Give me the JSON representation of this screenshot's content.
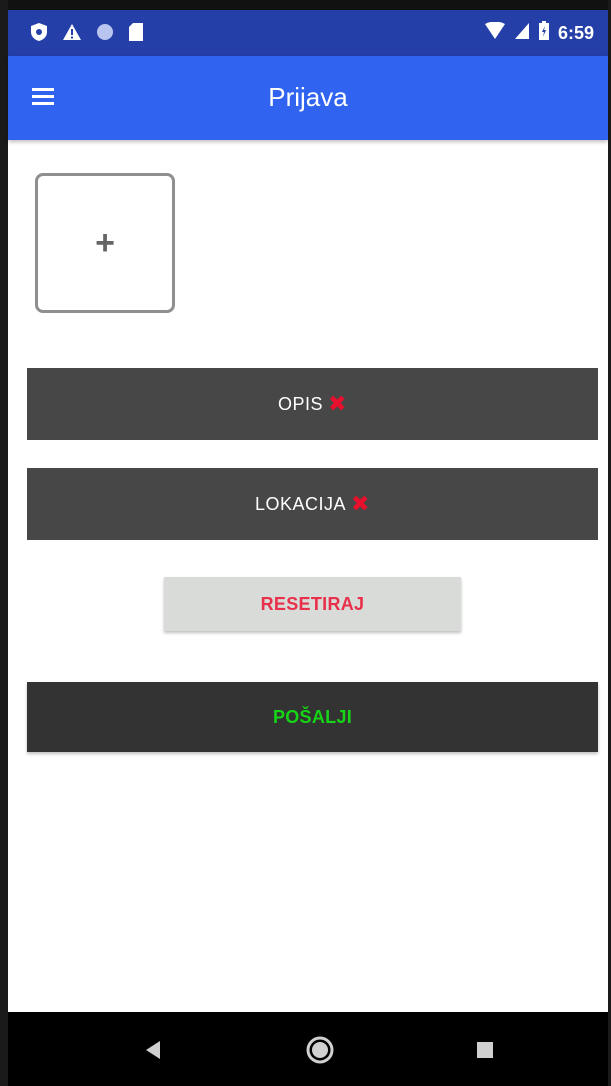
{
  "status_bar": {
    "time": "6:59",
    "left_icons": [
      "shield-icon",
      "warning-icon",
      "circle-icon",
      "sd-card-icon"
    ],
    "right_icons": [
      "wifi-icon",
      "signal-icon",
      "battery-icon"
    ]
  },
  "app_bar": {
    "title": "Prijava",
    "menu_icon": "menu-icon"
  },
  "photo_slot": {
    "icon": "plus-icon",
    "symbol": "+"
  },
  "fields": [
    {
      "label": "OPIS",
      "status_icon": "x-mark-icon",
      "status": "✖"
    },
    {
      "label": "LOKACIJA",
      "status_icon": "x-mark-icon",
      "status": "✖"
    }
  ],
  "buttons": {
    "reset_label": "RESETIRAJ",
    "send_label": "POŠALJI"
  },
  "colors": {
    "status_bar": "#243fa8",
    "app_bar": "#2f63f0",
    "field_bar": "#474747",
    "reset_bg": "#d9dbd9",
    "reset_text": "#e8304a",
    "send_bg": "#333333",
    "send_text": "#16d416",
    "error_mark": "#e8102c"
  },
  "nav_bar": {
    "icons": [
      "back-icon",
      "home-icon",
      "recent-apps-icon"
    ]
  }
}
